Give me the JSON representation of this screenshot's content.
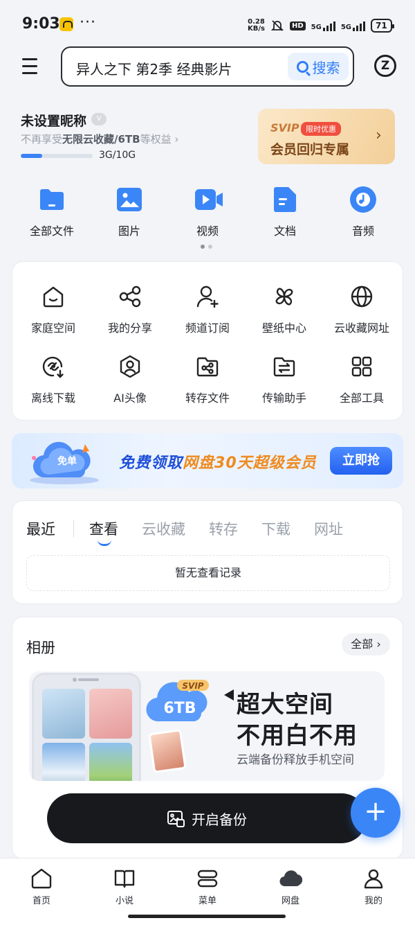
{
  "status_bar": {
    "time": "9:03",
    "dots": "···",
    "net_speed_value": "0.28",
    "net_speed_unit": "KB/s",
    "hd": "HD",
    "sim1": "5G",
    "sim2": "5G",
    "battery": "71"
  },
  "header": {
    "search_text": "异人之下 第2季 经典影片",
    "search_button": "搜索"
  },
  "user": {
    "name": "未设置昵称",
    "badge": "V",
    "sub_prefix": "不再享受",
    "sub_bold": "无限云收藏/6TB",
    "sub_suffix": "等权益 ›",
    "quota_text": "3G/10G",
    "quota_fraction": 0.3
  },
  "vip_card": {
    "svip": "SVIP",
    "tag": "限时优惠",
    "title": "会员回归专属",
    "arrow": "›"
  },
  "quick_entries": [
    {
      "label": "全部文件",
      "icon": "folder-icon",
      "color": "#3b86f7"
    },
    {
      "label": "图片",
      "icon": "image-icon",
      "color": "#3b86f7"
    },
    {
      "label": "视频",
      "icon": "video-icon",
      "color": "#3b86f7"
    },
    {
      "label": "文档",
      "icon": "document-icon",
      "color": "#3b86f7"
    },
    {
      "label": "音频",
      "icon": "music-icon",
      "color": "#3b86f7"
    }
  ],
  "tools": [
    {
      "label": "家庭空间",
      "icon": "home-icon"
    },
    {
      "label": "我的分享",
      "icon": "share-icon"
    },
    {
      "label": "频道订阅",
      "icon": "user-add-icon"
    },
    {
      "label": "壁纸中心",
      "icon": "pinwheel-icon"
    },
    {
      "label": "云收藏网址",
      "icon": "globe-icon"
    },
    {
      "label": "离线下载",
      "icon": "link-download-icon"
    },
    {
      "label": "AI头像",
      "icon": "avatar-hex-icon"
    },
    {
      "label": "转存文件",
      "icon": "folder-share-icon"
    },
    {
      "label": "传输助手",
      "icon": "transfer-icon"
    },
    {
      "label": "全部工具",
      "icon": "grid-icon"
    }
  ],
  "banner": {
    "text_a": "免费领取",
    "text_b": "网盘30天超级会员",
    "button": "立即抢",
    "cloud_text": "免单"
  },
  "recent": {
    "title": "最近",
    "tabs": [
      "查看",
      "云收藏",
      "转存",
      "下载",
      "网址"
    ],
    "active_tab": "查看",
    "empty": "暂无查看记录"
  },
  "album": {
    "title": "相册",
    "all": "全部 ›",
    "svip": "SVIP",
    "cap": "6TB",
    "line1": "超大空间",
    "line2": "不用白不用",
    "line3": "云端备份释放手机空间"
  },
  "backup_button": "开启备份",
  "fab": "+",
  "tabbar": [
    {
      "label": "首页",
      "icon": "home-tab-icon"
    },
    {
      "label": "小说",
      "icon": "book-icon"
    },
    {
      "label": "菜单",
      "icon": "menu-stack-icon"
    },
    {
      "label": "网盘",
      "icon": "cloud-icon"
    },
    {
      "label": "我的",
      "icon": "profile-icon"
    }
  ]
}
